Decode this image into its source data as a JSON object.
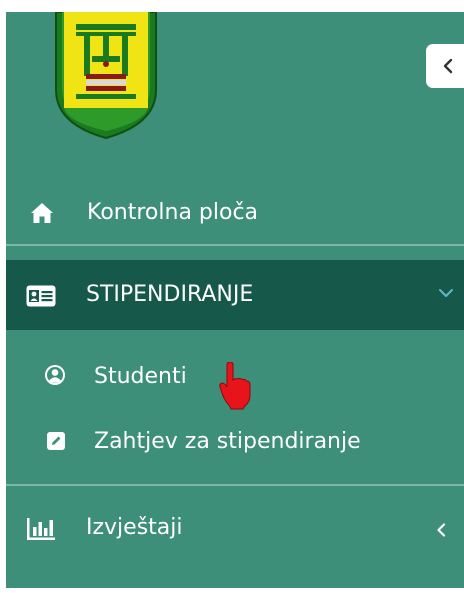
{
  "sidebar": {
    "items": [
      {
        "label": "Kontrolna ploča",
        "icon": "home-icon"
      },
      {
        "label": "STIPENDIRANJE",
        "icon": "id-card-icon",
        "expanded": true,
        "children": [
          {
            "label": "Studenti",
            "icon": "user-circle-icon"
          },
          {
            "label": "Zahtjev za stipendiranje",
            "icon": "edit-icon"
          }
        ]
      },
      {
        "label": "Izvještaji",
        "icon": "bar-chart-icon",
        "expanded": false
      }
    ]
  },
  "colors": {
    "sidebar_bg": "#3d8f79",
    "active_bg": "#16584a",
    "divider": "#78b8a5",
    "text": "#ffffff",
    "cursor": "#e8141b"
  }
}
